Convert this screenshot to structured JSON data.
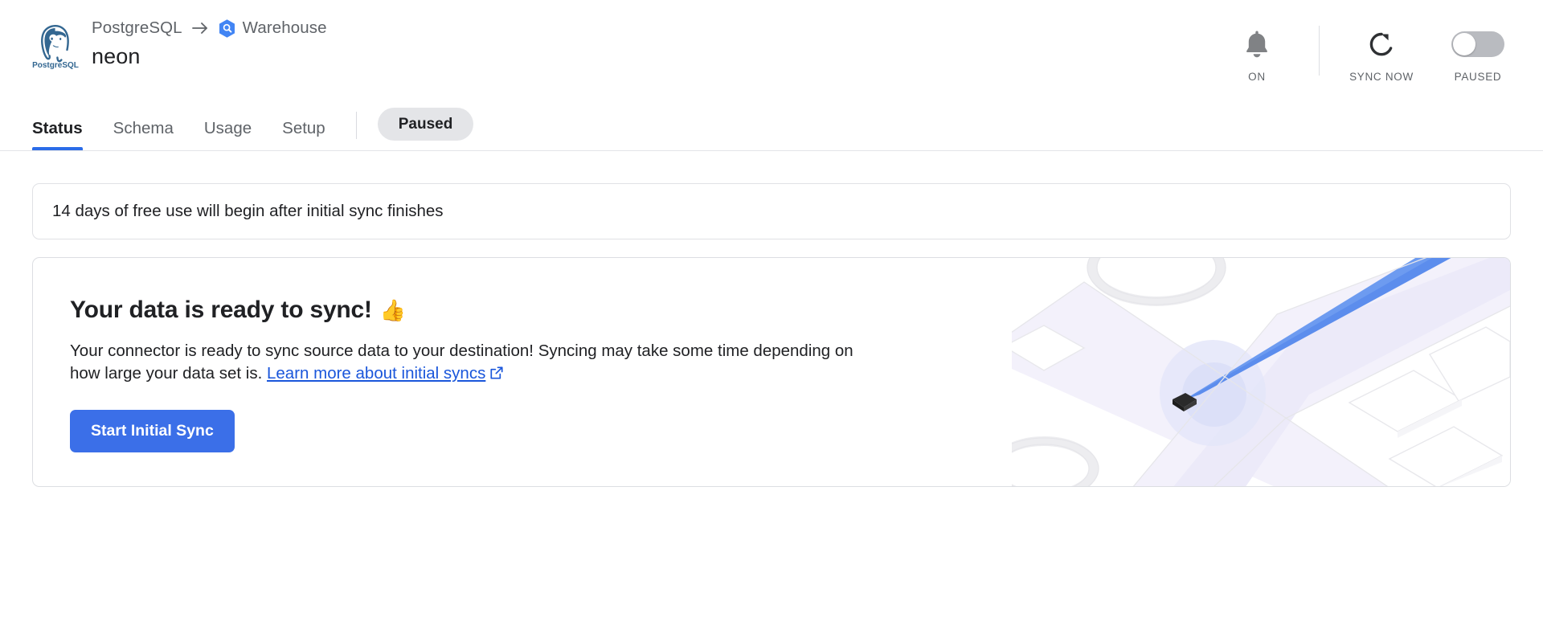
{
  "header": {
    "source_logo_name": "PostgreSQL",
    "breadcrumb": {
      "source": "PostgreSQL",
      "arrow": "→",
      "destination": "Warehouse"
    },
    "connector_name": "neon",
    "tabs": [
      {
        "label": "Status",
        "active": true
      },
      {
        "label": "Schema",
        "active": false
      },
      {
        "label": "Usage",
        "active": false
      },
      {
        "label": "Setup",
        "active": false
      }
    ],
    "status_pill": "Paused",
    "controls": [
      {
        "icon": "bell-icon",
        "label": "ON"
      },
      {
        "icon": "refresh-icon",
        "label": "SYNC NOW"
      },
      {
        "icon": "toggle-switch",
        "label": "PAUSED",
        "state": "off"
      }
    ]
  },
  "main": {
    "notice": "14 days of free use will begin after initial sync finishes",
    "ready_card": {
      "title": "Your data is ready to sync!",
      "title_emoji": "👍",
      "body_text_1": "Your connector is ready to sync source data to your destination! Syncing may take some time depending on how large your data set is. ",
      "link_text": "Learn more about initial syncs",
      "button_label": "Start Initial Sync"
    }
  },
  "colors": {
    "accent_blue": "#3b6fe8",
    "tab_underline": "#2b6ce8",
    "link_blue": "#1a56db",
    "postgres_blue": "#336791",
    "pill_gray": "#e4e5e8",
    "muted_text": "#5f6368"
  }
}
